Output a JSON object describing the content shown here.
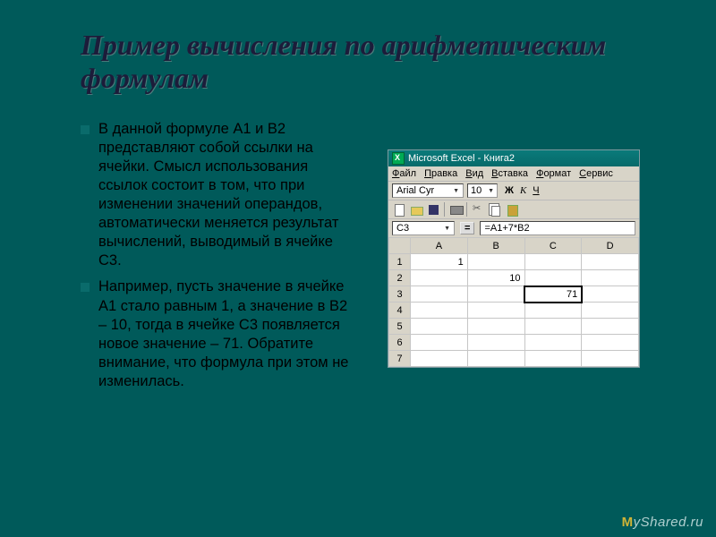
{
  "slide": {
    "title": "Пример вычисления по арифметическим формулам",
    "bullets": [
      "В данной формуле A1 и B2 представляют собой ссылки на ячейки. Смысл использования ссылок состоит в том, что при изменении значений операндов, автоматически меняется результат вычислений, выводимый в ячейке C3.",
      "Например, пусть значение в ячейке А1 стало равным 1, а значение в В2 – 10, тогда в ячейке С3 появляется новое значение – 71. Обратите внимание, что формула при этом не изменилась."
    ]
  },
  "excel": {
    "title": "Microsoft Excel - Книга2",
    "menu": [
      "Файл",
      "Правка",
      "Вид",
      "Вставка",
      "Формат",
      "Сервис"
    ],
    "font": "Arial Cyr",
    "fontSize": "10",
    "format_buttons": {
      "bold": "Ж",
      "italic": "К",
      "underline": "Ч"
    },
    "nameBox": "C3",
    "formula": "=A1+7*B2",
    "columns": [
      "A",
      "B",
      "C",
      "D"
    ],
    "rows": [
      {
        "n": "1",
        "A": "1",
        "B": "",
        "C": "",
        "D": ""
      },
      {
        "n": "2",
        "A": "",
        "B": "10",
        "C": "",
        "D": ""
      },
      {
        "n": "3",
        "A": "",
        "B": "",
        "C": "71",
        "D": ""
      },
      {
        "n": "4",
        "A": "",
        "B": "",
        "C": "",
        "D": ""
      },
      {
        "n": "5",
        "A": "",
        "B": "",
        "C": "",
        "D": ""
      },
      {
        "n": "6",
        "A": "",
        "B": "",
        "C": "",
        "D": ""
      },
      {
        "n": "7",
        "A": "",
        "B": "",
        "C": "",
        "D": ""
      }
    ],
    "selected": {
      "row": "3",
      "col": "C"
    }
  },
  "watermark": {
    "prefix": "M",
    "rest": "yShared.ru"
  }
}
